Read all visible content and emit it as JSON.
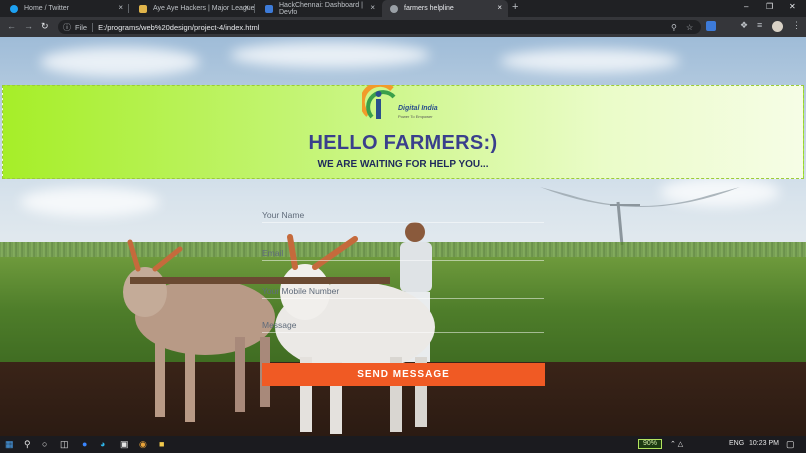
{
  "browser": {
    "tabs": [
      {
        "title": "Home / Twitter",
        "fav_color": "#1da1f2",
        "active": false
      },
      {
        "title": "Aye Aye Hackers | Major League",
        "fav_color": "#e0b44a",
        "active": false
      },
      {
        "title": "HackChennai: Dashboard | Devfo",
        "fav_color": "#3d7bd9",
        "active": false
      },
      {
        "title": "farmers helpline",
        "fav_color": "#9aa0a6",
        "active": true
      }
    ],
    "new_tab_glyph": "+",
    "close_glyph": "×",
    "window_controls": {
      "minimize": "–",
      "restore": "❐",
      "close": "✕"
    },
    "address": {
      "info_glyph": "ⓘ",
      "scheme_label": "File",
      "url": "E:/programs/web%20design/project-4/index.html"
    }
  },
  "page": {
    "logo": {
      "title": "Digital India",
      "tagline": "Power To Empower"
    },
    "heading": "HELLO FARMERS:)",
    "subheading": "WE ARE WAITING FOR HELP YOU...",
    "form": {
      "name_placeholder": "Your Name",
      "email_placeholder": "Email",
      "mobile_placeholder": "Your Mobile Number",
      "message_placeholder": "Message",
      "submit_label": "SEND MESSAGE"
    },
    "colors": {
      "header_green": "#a6ee28",
      "button_orange": "#f05a24",
      "heading_blue": "#3a3f8c"
    }
  },
  "taskbar": {
    "battery": "90%",
    "language": "ENG",
    "time": "10:23 PM"
  }
}
